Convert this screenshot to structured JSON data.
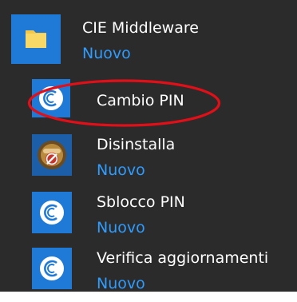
{
  "menu": {
    "group": {
      "title": "CIE Middleware",
      "badge": "Nuovo",
      "icon": "folder-icon"
    },
    "items": [
      {
        "label": "Cambio PIN",
        "badge": "",
        "icon": "cie-logo-icon",
        "highlighted": true
      },
      {
        "label": "Disinstalla",
        "badge": "Nuovo",
        "icon": "uninstall-icon"
      },
      {
        "label": "Sblocco PIN",
        "badge": "Nuovo",
        "icon": "cie-logo-icon"
      },
      {
        "label": "Verifica aggiornamenti",
        "badge": "Nuovo",
        "icon": "cie-logo-icon"
      }
    ]
  },
  "colors": {
    "background": "#2b2b2b",
    "tile": "#1e7ad6",
    "text": "#ffffff",
    "badge": "#2f9cff",
    "annotation": "#e10f18"
  }
}
